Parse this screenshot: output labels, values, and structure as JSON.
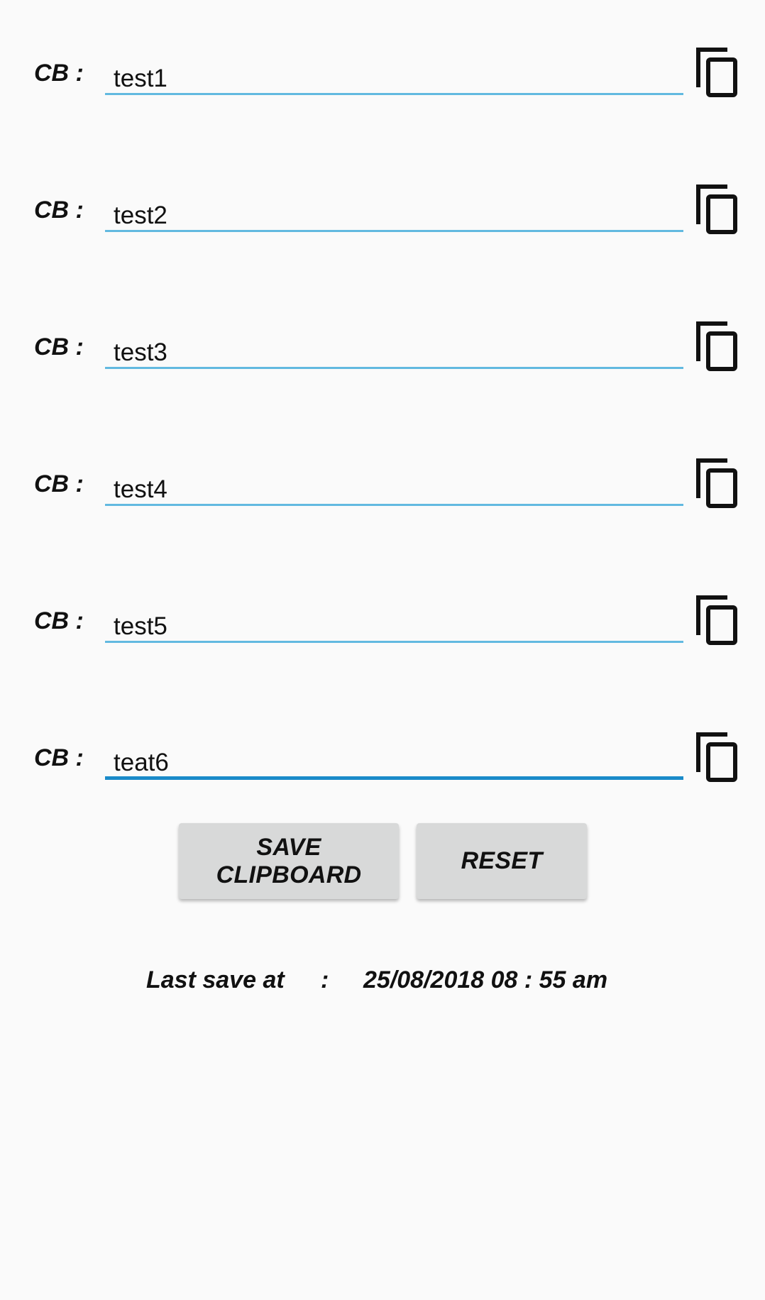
{
  "clipboards": [
    {
      "label": "CB :",
      "value": "test1"
    },
    {
      "label": "CB :",
      "value": "test2"
    },
    {
      "label": "CB :",
      "value": "test3"
    },
    {
      "label": "CB :",
      "value": "test4"
    },
    {
      "label": "CB :",
      "value": "test5"
    },
    {
      "label": "CB :",
      "value": "teat6"
    }
  ],
  "copy_icon": "copy-icon",
  "buttons": {
    "save_label": "SAVE CLIPBOARD",
    "reset_label": "RESET"
  },
  "last_save": {
    "label": "Last save at",
    "separator": ":",
    "value": "25/08/2018 08 : 55 am"
  },
  "colors": {
    "underline": "#62b9e0",
    "underline_focused": "#1a8ac9",
    "button_bg": "#d8d9d9",
    "background": "#fafafa"
  }
}
